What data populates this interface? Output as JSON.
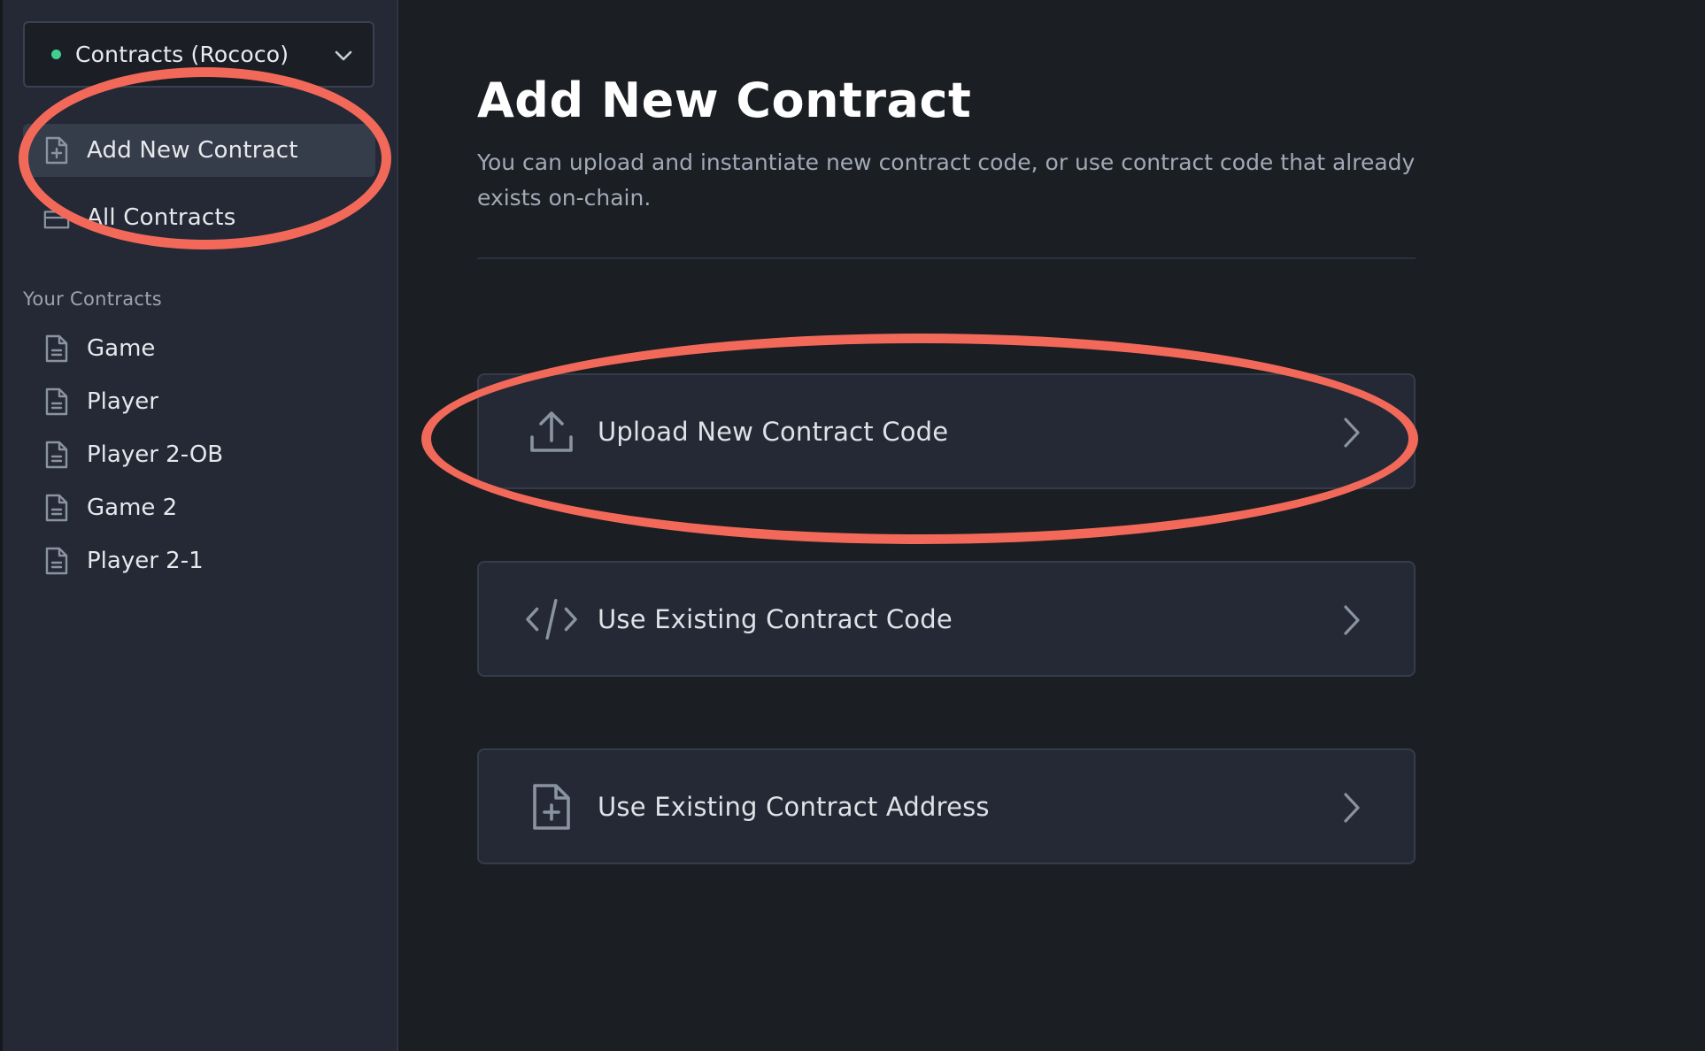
{
  "sidebar": {
    "network_selector": {
      "label": "Contracts (Rococo)",
      "status_color": "#3fcf8e"
    },
    "nav": [
      {
        "label": "Add New Contract",
        "icon": "file-plus-icon",
        "active": true
      },
      {
        "label": "All Contracts",
        "icon": "folder-icon",
        "active": false
      }
    ],
    "section_label": "Your Contracts",
    "contracts": [
      {
        "label": "Game",
        "icon": "document-icon"
      },
      {
        "label": "Player",
        "icon": "document-icon"
      },
      {
        "label": "Player 2-OB",
        "icon": "document-icon"
      },
      {
        "label": "Game 2",
        "icon": "document-icon"
      },
      {
        "label": "Player 2-1",
        "icon": "document-icon"
      }
    ]
  },
  "main": {
    "title": "Add New Contract",
    "description": "You can upload and instantiate new contract code, or use contract code that already exists on-chain.",
    "options": [
      {
        "label": "Upload New Contract Code",
        "icon": "upload-icon"
      },
      {
        "label": "Use Existing Contract Code",
        "icon": "code-icon"
      },
      {
        "label": "Use Existing Contract Address",
        "icon": "file-plus-icon"
      }
    ]
  },
  "annotation_color": "#f2695a"
}
